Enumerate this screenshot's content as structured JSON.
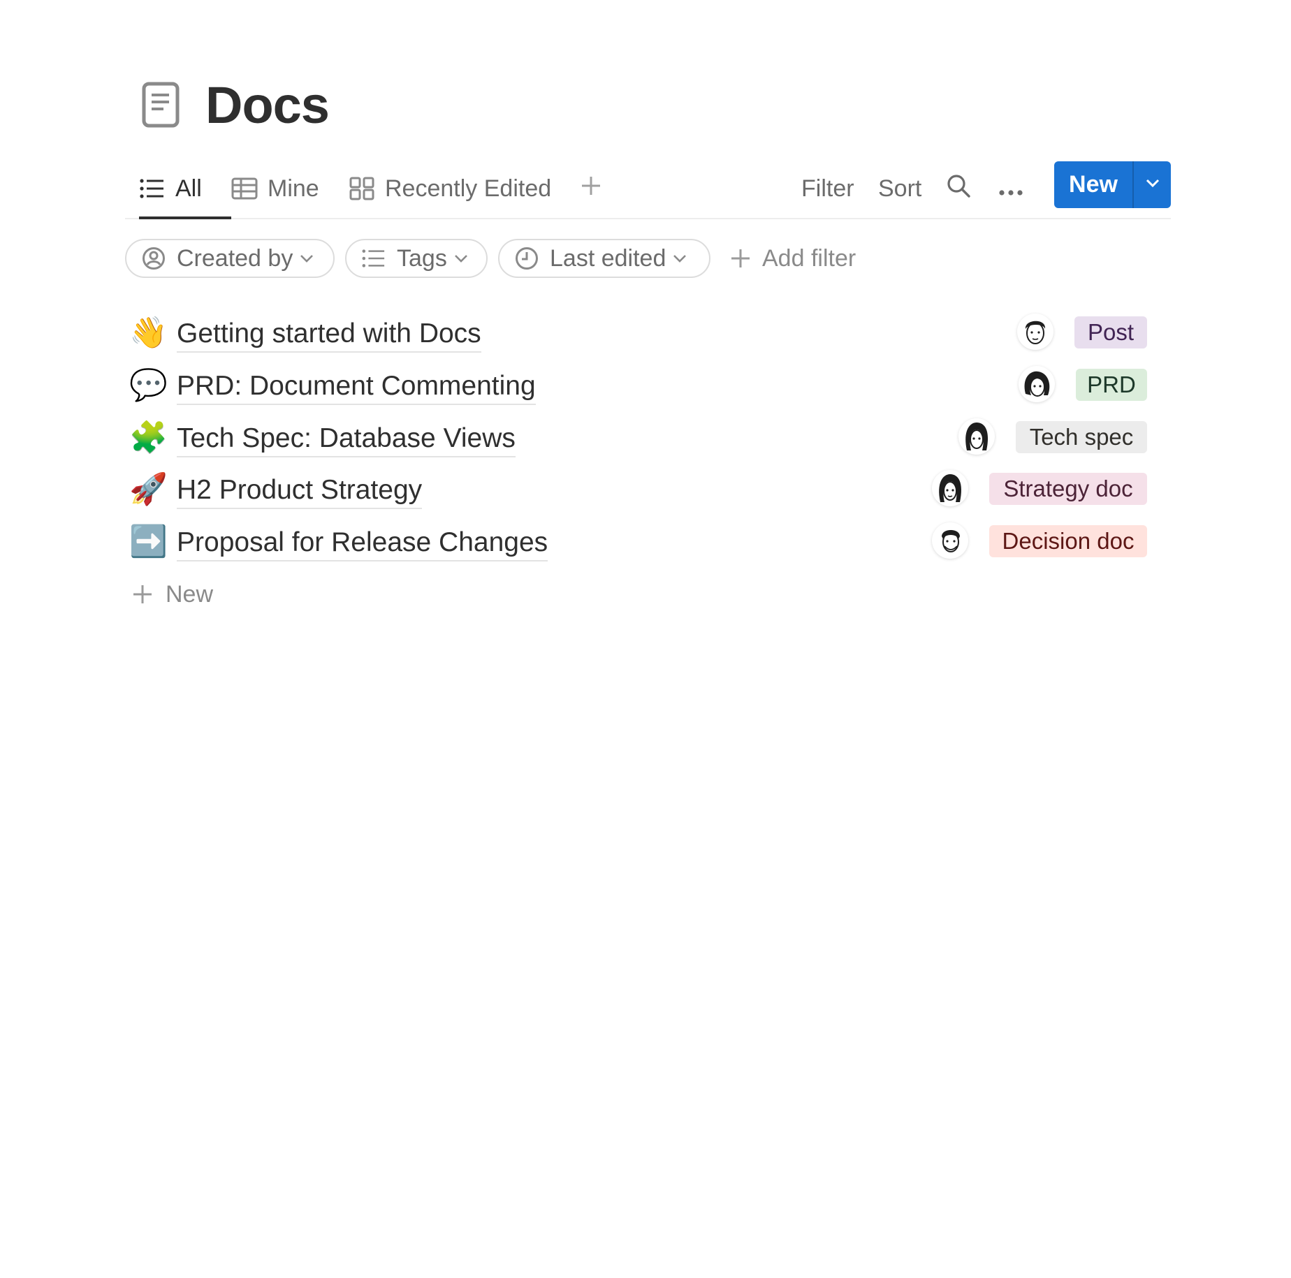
{
  "page": {
    "title": "Docs",
    "title_icon": "document-icon"
  },
  "tabs": [
    {
      "label": "All",
      "icon": "list-icon",
      "active": true
    },
    {
      "label": "Mine",
      "icon": "table-icon",
      "active": false
    },
    {
      "label": "Recently Edited",
      "icon": "gallery-icon",
      "active": false
    }
  ],
  "toolbar": {
    "filter_label": "Filter",
    "sort_label": "Sort",
    "new_label": "New",
    "accent_color": "#1a73d4"
  },
  "filters": [
    {
      "label": "Created by",
      "icon": "person-icon"
    },
    {
      "label": "Tags",
      "icon": "list-icon"
    },
    {
      "label": "Last edited",
      "icon": "clock-icon"
    }
  ],
  "add_filter_label": "Add filter",
  "docs": [
    {
      "emoji": "👋",
      "title": "Getting started with Docs",
      "tag": "Post",
      "tag_bg": "#e8deee",
      "tag_color": "#412454"
    },
    {
      "emoji": "💬",
      "title": "PRD: Document Commenting",
      "tag": "PRD",
      "tag_bg": "#dbeddb",
      "tag_color": "#1c3829"
    },
    {
      "emoji": "🧩",
      "title": "Tech Spec: Database Views",
      "tag": "Tech spec",
      "tag_bg": "#ececec",
      "tag_color": "#32302c"
    },
    {
      "emoji": "🚀",
      "title": "H2 Product Strategy",
      "tag": "Strategy doc",
      "tag_bg": "#f5e0e9",
      "tag_color": "#4c2337"
    },
    {
      "emoji": "➡️",
      "title": "Proposal for Release Changes",
      "tag": "Decision doc",
      "tag_bg": "#ffe2dd",
      "tag_color": "#5d1715"
    }
  ],
  "new_row_label": "New"
}
